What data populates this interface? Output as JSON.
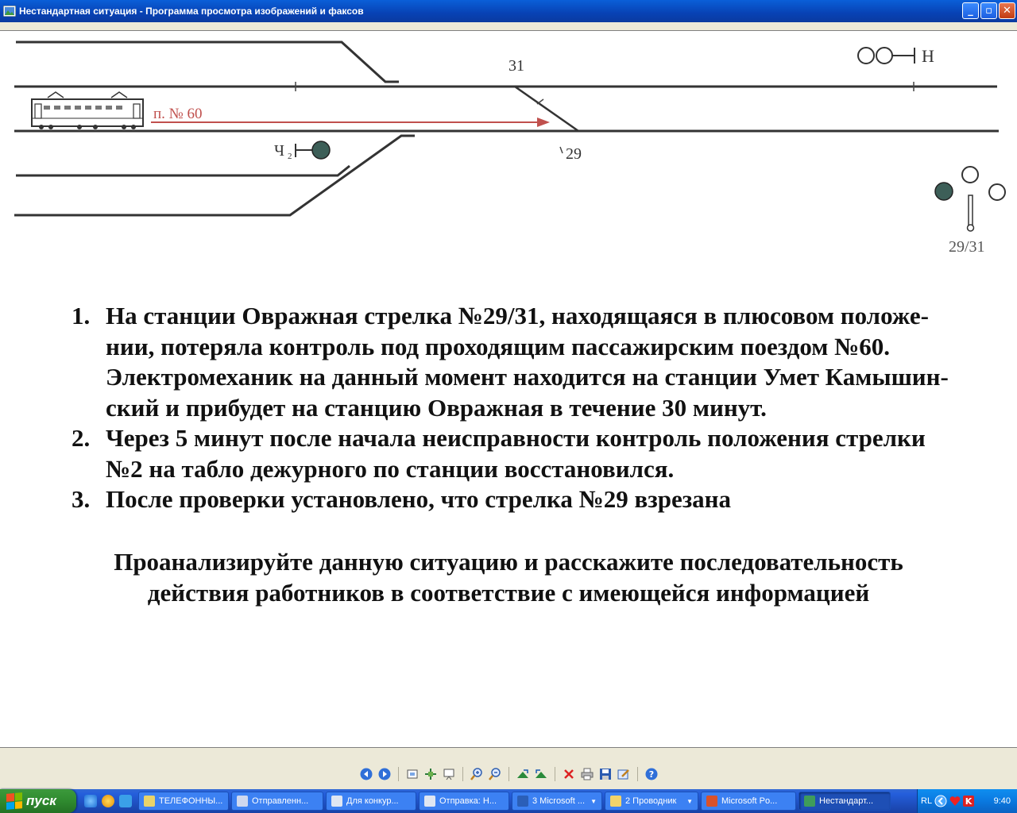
{
  "window": {
    "title": "Нестандартная ситуация - Программа просмотра изображений и факсов",
    "minimize": "_",
    "maximize": "▫",
    "close": "✕"
  },
  "diagram": {
    "train_label": "п. № 60",
    "switch_31": "31",
    "switch_29": "29",
    "signal_ch2": "Ч",
    "signal_ch2_sub": "2",
    "signal_h": "Н",
    "signal_2931": "29/31"
  },
  "task_list": [
    {
      "num": "1.",
      "lines": [
        "На станции Овражная стрелка №29/31, находящаяся в плюсовом положе-",
        "нии, потеряла контроль под проходящим пассажирским поездом №60.",
        "Электромеханик на данный момент находится на станции Умет Камышин-",
        "ский и прибудет на станцию Овражная в течение 30 минут."
      ]
    },
    {
      "num": "2.",
      "lines": [
        "Через 5 минут после начала неисправности контроль положения стрелки",
        "№2 на табло дежурного по станции восстановился."
      ]
    },
    {
      "num": "3.",
      "lines": [
        "После проверки установлено, что стрелка №29 взрезана"
      ]
    }
  ],
  "footer": {
    "line1": "Проанализируйте данную ситуацию и расскажите последовательность",
    "line2": "действия работников в соответствие с имеющейся информацией"
  },
  "taskbar": {
    "start_label": "пуск",
    "tasks": [
      {
        "label": "ТЕЛЕФОННЫ...",
        "icon_color": "#e9d36a"
      },
      {
        "label": "Отправленн...",
        "icon_color": "#cfd8ef"
      },
      {
        "label": "Для конкур...",
        "icon_color": "#dfe6f2"
      },
      {
        "label": "Отправка: Н...",
        "icon_color": "#dfe6f2"
      },
      {
        "label": "3 Microsoft ...",
        "icon_color": "#2b5fb8"
      },
      {
        "label": "2 Проводник",
        "icon_color": "#f2d36a"
      },
      {
        "label": "Microsoft Po...",
        "icon_color": "#d9522b"
      },
      {
        "label": "Нестандарт...",
        "icon_color": "#3f9c5a"
      }
    ],
    "language": "RL",
    "clock": "9:40"
  }
}
